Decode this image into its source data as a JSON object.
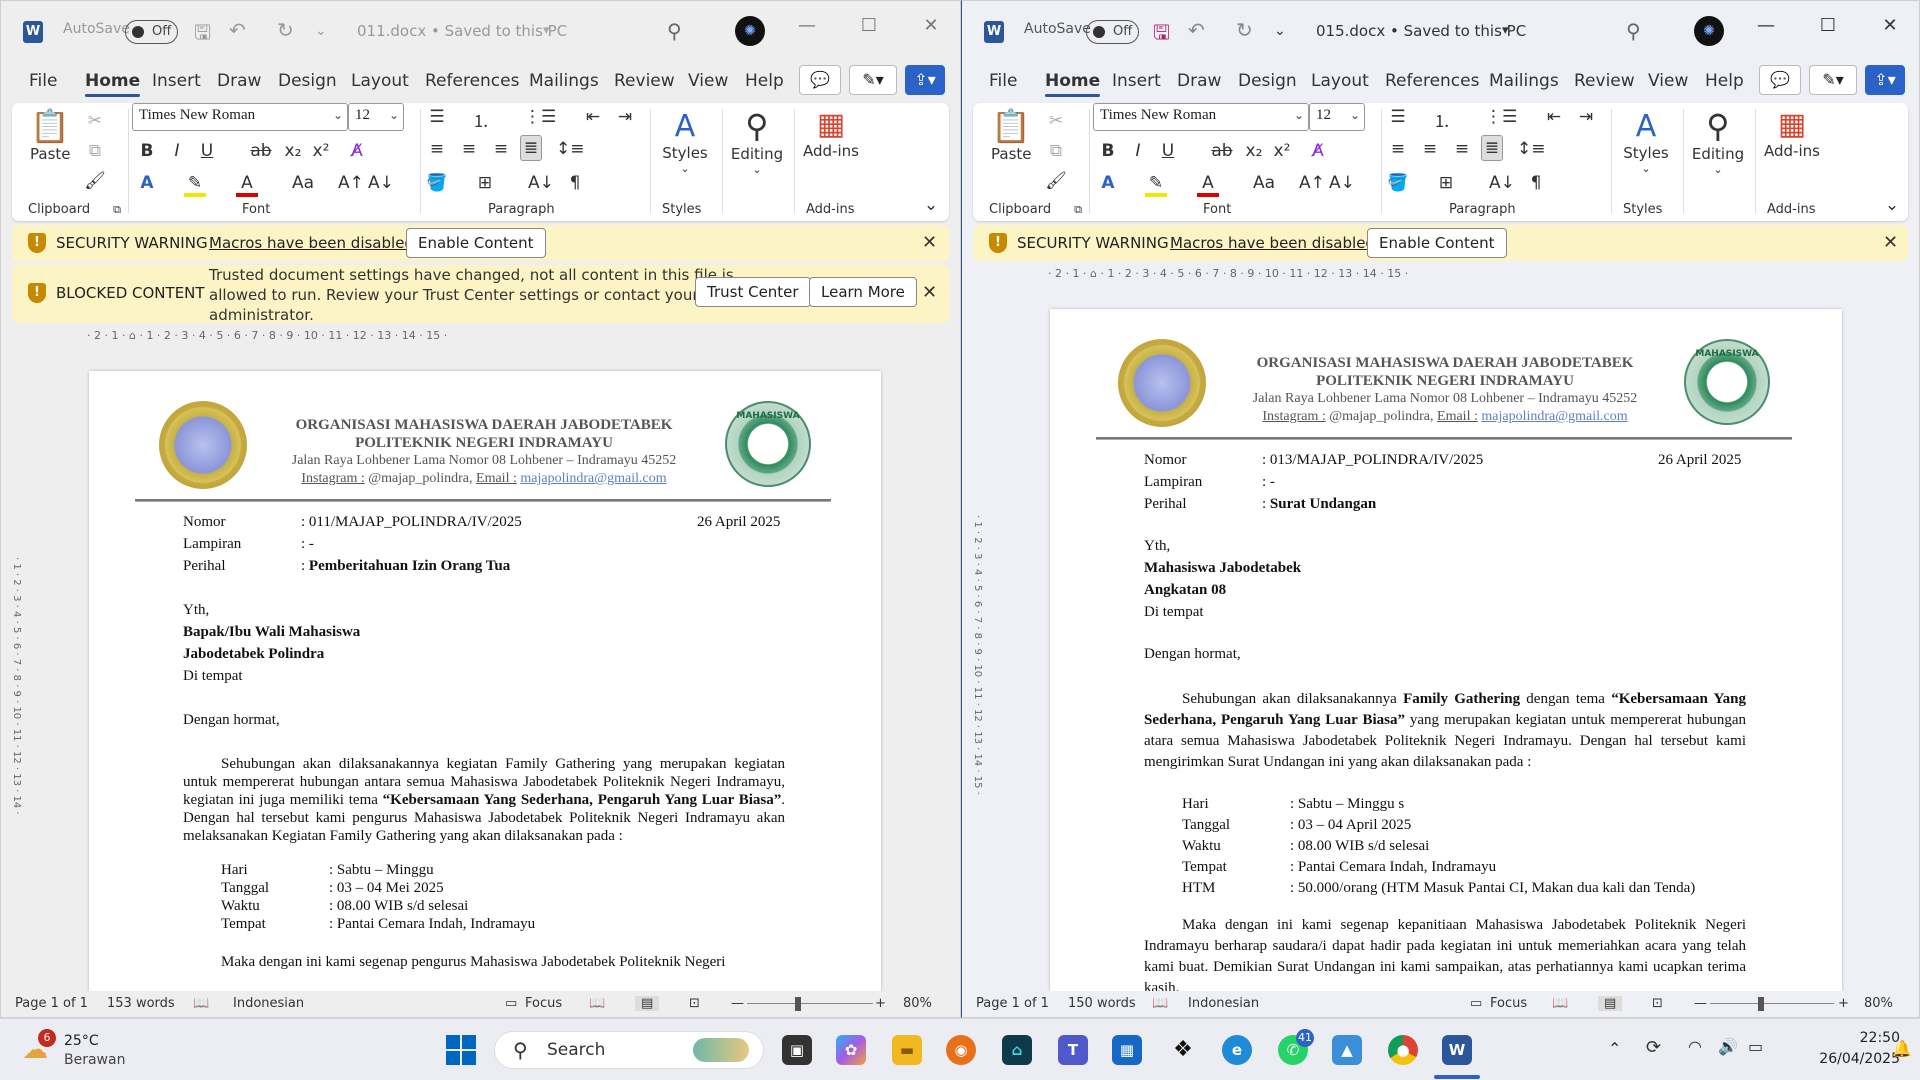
{
  "left": {
    "autosave": "AutoSave",
    "toggle": "Off",
    "title": "011.docx  •  Saved to this PC",
    "menus": [
      "File",
      "Home",
      "Insert",
      "Draw",
      "Design",
      "Layout",
      "References",
      "Mailings",
      "Review",
      "View",
      "Help"
    ],
    "font": "Times New Roman",
    "size": "12",
    "groups": {
      "clipboard": "Clipboard",
      "font": "Font",
      "paragraph": "Paragraph",
      "styles": "Styles",
      "addins": "Add-ins"
    },
    "paste": "Paste",
    "styles_btn": "Styles",
    "editing_btn": "Editing",
    "addins_btn": "Add-ins",
    "warn1": {
      "title": "SECURITY WARNING",
      "link": "Macros have been disabled.",
      "button": "Enable Content"
    },
    "warn2": {
      "title": "BLOCKED CONTENT",
      "line1": "Trusted document settings have changed, not all content in this file is",
      "line2": "allowed to run. Review your Trust Center settings or contact your IT",
      "line3": "administrator.",
      "btn1": "Trust Center",
      "btn2": "Learn More"
    },
    "ruler": "· 2 · 1 · ⌂ · 1 · 2 · 3 · 4 · 5 · 6 · 7 · 8 · 9 · 10 · 11 · 12 · 13 · 14 · 15 ·",
    "vruler": "· 1 · 2 · 3 · 4 · 5 · 6 · 7 · 8 · 9 · 10 · 11 · 12 · 13 · 14 ·",
    "letter": {
      "org1": "ORGANISASI MAHASISWA DAERAH JABODETABEK",
      "org2": "POLITEKNIK NEGERI INDRAMAYU",
      "addr": "Jalan Raya Lohbener Lama Nomor 08 Lohbener – Indramayu 45252",
      "ig_label": "Instagram :",
      "ig": " @majap_polindra, ",
      "email_label": "Email :",
      "email": "majapolindra@gmail.com",
      "logo_text": "MAHASISWA",
      "nomor_l": "Nomor",
      "nomor_v": ": 011/MAJAP_POLINDRA/IV/2025",
      "date": "26 April 2025",
      "lamp_l": "Lampiran",
      "lamp_v": ": -",
      "hal_l": "Perihal",
      "hal_c": ": ",
      "hal_v": "Pemberitahuan Izin Orang Tua",
      "yth": "Yth,",
      "to1": "Bapak/Ibu Wali Mahasiswa",
      "to2": "Jabodetabek Polindra",
      "to3": "Di tempat",
      "greet": "Dengan hormat,",
      "p1a": "Sehubungan akan dilaksanakannya kegiatan Family Gathering yang merupakan kegiatan untuk mempererat hubungan antara semua Mahasiswa Jabodetabek Politeknik Negeri Indramayu, kegiatan ini juga memiliki tema ",
      "p1b": "“Kebersamaan Yang Sederhana, Pengaruh Yang Luar Biasa”",
      "p1c": ". Dengan hal tersebut kami pengurus Mahasiswa Jabodetabek Politeknik Negeri Indramayu akan melaksanakan Kegiatan Family Gathering yang akan dilaksanakan pada :",
      "hari_l": "Hari",
      "hari_v": ": Sabtu – Minggu",
      "tgl_l": "Tanggal",
      "tgl_v": ": 03 – 04 Mei 2025",
      "wkt_l": "Waktu",
      "wkt_v": ": 08.00 WIB s/d selesai",
      "tmp_l": "Tempat",
      "tmp_v": ": Pantai Cemara Indah, Indramayu",
      "p2": "Maka dengan ini kami segenap pengurus Mahasiswa Jabodetabek Politeknik Negeri"
    },
    "status": {
      "page": "Page 1 of 1",
      "words": "153 words",
      "lang": "Indonesian",
      "focus": "Focus",
      "zoom": "80%"
    }
  },
  "right": {
    "autosave": "AutoSave",
    "toggle": "Off",
    "title": "015.docx  •  Saved to this PC",
    "menus": [
      "File",
      "Home",
      "Insert",
      "Draw",
      "Design",
      "Layout",
      "References",
      "Mailings",
      "Review",
      "View",
      "Help"
    ],
    "font": "Times New Roman",
    "size": "12",
    "groups": {
      "clipboard": "Clipboard",
      "font": "Font",
      "paragraph": "Paragraph",
      "styles": "Styles",
      "addins": "Add-ins"
    },
    "paste": "Paste",
    "styles_btn": "Styles",
    "editing_btn": "Editing",
    "addins_btn": "Add-ins",
    "warn1": {
      "title": "SECURITY WARNING",
      "link": "Macros have been disabled.",
      "button": "Enable Content"
    },
    "ruler": "· 2 · 1 · ⌂ · 1 · 2 · 3 · 4 · 5 · 6 · 7 · 8 · 9 · 10 · 11 · 12 · 13 · 14 · 15 ·",
    "vruler": "· 1 · 2 · 3 · 4 · 5 · 6 · 7 · 8 · 9 · 10 · 11 · 12 · 13 · 14 · 15 ·",
    "letter": {
      "org1": "ORGANISASI MAHASISWA DAERAH JABODETABEK",
      "org2": "POLITEKNIK NEGERI INDRAMAYU",
      "addr": "Jalan Raya Lohbener Lama Nomor 08 Lohbener – Indramayu 45252",
      "ig_label": "Instagram :",
      "ig": " @majap_polindra, ",
      "email_label": "Email :",
      "email": "majapolindra@gmail.com",
      "logo_text": "MAHASISWA",
      "nomor_l": "Nomor",
      "nomor_v": ": 013/MAJAP_POLINDRA/IV/2025",
      "date": "26 April 2025",
      "lamp_l": "Lampiran",
      "lamp_v": ": -",
      "hal_l": "Perihal",
      "hal_c": ": ",
      "hal_v": "Surat Undangan",
      "yth": "Yth,",
      "to1": "Mahasiswa Jabodetabek",
      "to2": "Angkatan 08",
      "to3": "Di tempat",
      "greet": "Dengan hormat,",
      "p1a": "Sehubungan akan dilaksanakannya ",
      "p1b": "Family Gathering",
      "p1c": " dengan tema ",
      "p1d": "“Kebersamaan Yang Sederhana, Pengaruh Yang Luar Biasa”",
      "p1e": " yang merupakan kegiatan untuk mempererat hubungan atara semua Mahasiswa Jabodetabek Politeknik Negeri Indramayu. Dengan hal tersebut kami mengirimkan Surat Undangan ini yang akan dilaksanakan pada :",
      "hari_l": "Hari",
      "hari_v": ": Sabtu – Minggu s",
      "tgl_l": "Tanggal",
      "tgl_v": ": 03 – 04 April 2025",
      "wkt_l": "Waktu",
      "wkt_v": ": 08.00 WIB s/d selesai",
      "tmp_l": "Tempat",
      "tmp_v": ": Pantai Cemara Indah, Indramayu",
      "htm_l": "HTM",
      "htm_v": ": 50.000/orang (HTM Masuk Pantai CI, Makan dua kali dan Tenda)",
      "p2": "Maka dengan ini kami segenap kepanitiaan Mahasiswa Jabodetabek Politeknik Negeri Indramayu berharap saudara/i dapat hadir pada kegiatan ini untuk memeriahkan acara yang telah kami buat. Demikian Surat Undangan ini kami sampaikan, atas perhatiannya kami ucapkan terima kasih."
    },
    "status": {
      "page": "Page 1 of 1",
      "words": "150 words",
      "lang": "Indonesian",
      "focus": "Focus",
      "zoom": "80%"
    }
  },
  "taskbar": {
    "temp": "25°C",
    "weather": "Berawan",
    "weather_badge": "6",
    "search": "Search",
    "whatsapp_badge": "41",
    "time": "22:50",
    "date": "26/04/2025"
  }
}
